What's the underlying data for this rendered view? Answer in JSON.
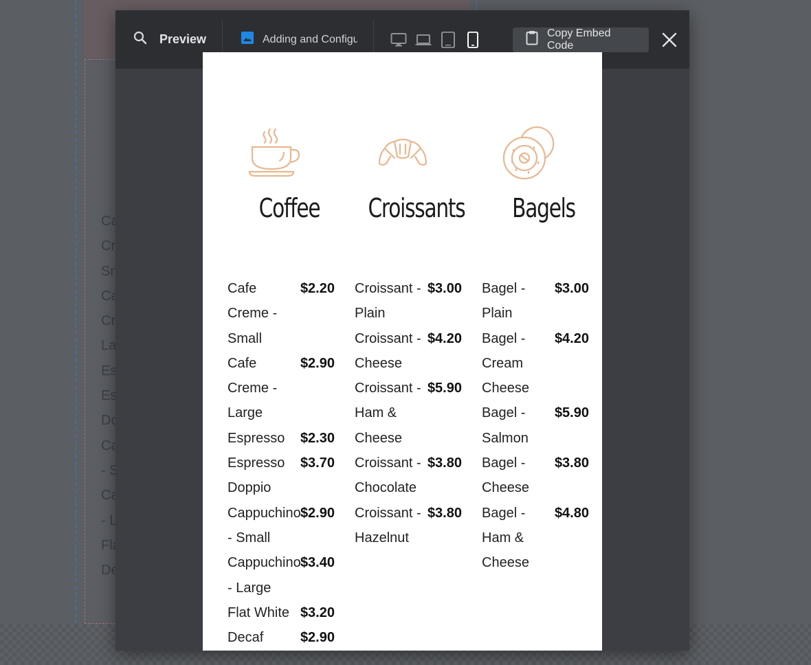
{
  "background": {
    "text_lines": [
      "Ca",
      "Cr",
      "Sn",
      "Ca",
      "Cr",
      "La",
      "Es",
      "Es",
      "Do",
      "Ca",
      "- S",
      "Ca",
      "- L",
      "Fla",
      "De"
    ]
  },
  "toolbar": {
    "preview_label": "Preview",
    "page_name": "Adding and Configu",
    "devices": [
      "desktop",
      "laptop",
      "tablet",
      "mobile"
    ],
    "active_device": "mobile",
    "copy_embed_label": "Copy Embed Code"
  },
  "menu": {
    "columns": [
      {
        "title": "Coffee",
        "icon": "coffee-cup-icon",
        "items": [
          {
            "name": "Cafe Creme - Small",
            "price": "$2.20"
          },
          {
            "name": "Cafe Creme - Large",
            "price": "$2.90"
          },
          {
            "name": "Espresso",
            "price": "$2.30"
          },
          {
            "name": "Espresso Doppio",
            "price": "$3.70"
          },
          {
            "name": "Cappuchino - Small",
            "price": "$2.90"
          },
          {
            "name": "Cappuchino - Large",
            "price": "$3.40"
          },
          {
            "name": "Flat White",
            "price": "$3.20"
          },
          {
            "name": "Decaf",
            "price": "$2.90"
          }
        ]
      },
      {
        "title": "Croissants",
        "icon": "croissant-icon",
        "items": [
          {
            "name": "Croissant - Plain",
            "price": "$3.00"
          },
          {
            "name": "Croissant - Cheese",
            "price": "$4.20"
          },
          {
            "name": "Croissant - Ham & Cheese",
            "price": "$5.90"
          },
          {
            "name": "Croissant - Chocolate",
            "price": "$3.80"
          },
          {
            "name": "Croissant - Hazelnut",
            "price": "$3.80"
          }
        ]
      },
      {
        "title": "Bagels",
        "icon": "bagel-icon",
        "items": [
          {
            "name": "Bagel - Plain",
            "price": "$3.00"
          },
          {
            "name": "Bagel - Cream Cheese",
            "price": "$4.20"
          },
          {
            "name": "Bagel - Salmon",
            "price": "$5.90"
          },
          {
            "name": "Bagel - Cheese",
            "price": "$3.80"
          },
          {
            "name": "Bagel - Ham & Cheese",
            "price": "$4.80"
          }
        ]
      }
    ]
  },
  "colors": {
    "icon_accent": "#e8b790",
    "toolbar_bg": "#2c2e32",
    "active_device": "#ffffff"
  }
}
